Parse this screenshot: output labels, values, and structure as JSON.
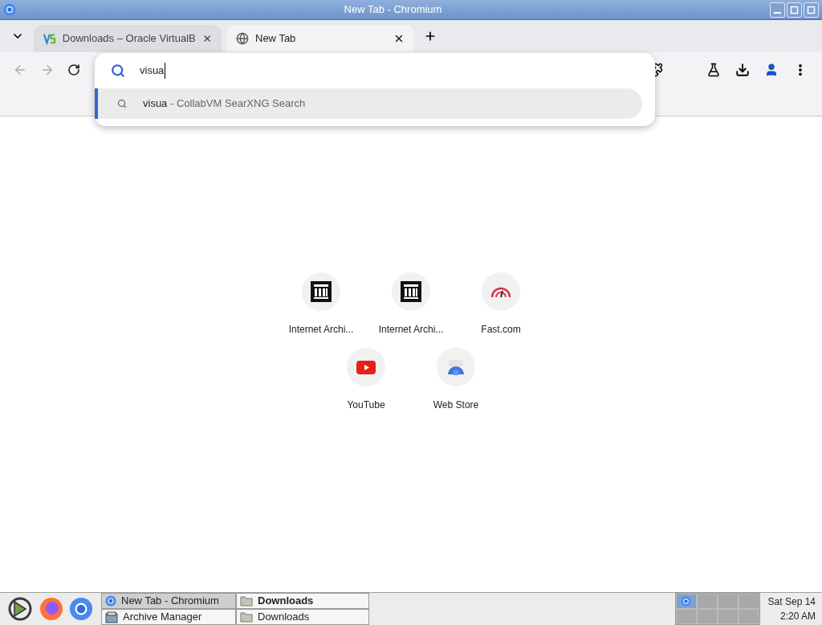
{
  "window": {
    "title": "New Tab - Chromium"
  },
  "tabs": [
    {
      "title": "Downloads – Oracle VirtualB",
      "kind": "vbox",
      "selected": false
    },
    {
      "title": "New Tab",
      "kind": "globe",
      "selected": true
    }
  ],
  "omnibox": {
    "value": "visua",
    "suggestions": [
      {
        "query": "visua",
        "source": " - CollabVM SearXNG Search",
        "selected": true
      }
    ]
  },
  "shortcuts": [
    {
      "label": "Internet Archi...",
      "kind": "archive"
    },
    {
      "label": "Internet Archi...",
      "kind": "archive"
    },
    {
      "label": "Fast.com",
      "kind": "gauge"
    },
    {
      "label": "YouTube",
      "kind": "youtube"
    },
    {
      "label": "Web Store",
      "kind": "store"
    }
  ],
  "taskbar": {
    "tasks": [
      {
        "label": "New Tab - Chromium",
        "kind": "chromium",
        "selected": true,
        "bold": false
      },
      {
        "label": "Downloads",
        "kind": "folder",
        "selected": false,
        "bold": true
      },
      {
        "label": "Archive Manager",
        "kind": "archive",
        "selected": false,
        "bold": false
      },
      {
        "label": "Downloads",
        "kind": "folder",
        "selected": false,
        "bold": false
      }
    ],
    "workspaces": [
      {
        "selected": true
      },
      {
        "selected": false
      },
      {
        "selected": false
      },
      {
        "selected": false
      },
      {
        "selected": false
      },
      {
        "selected": false
      },
      {
        "selected": false
      },
      {
        "selected": false
      }
    ],
    "date": "Sat Sep 14",
    "time": "2:20 AM"
  }
}
